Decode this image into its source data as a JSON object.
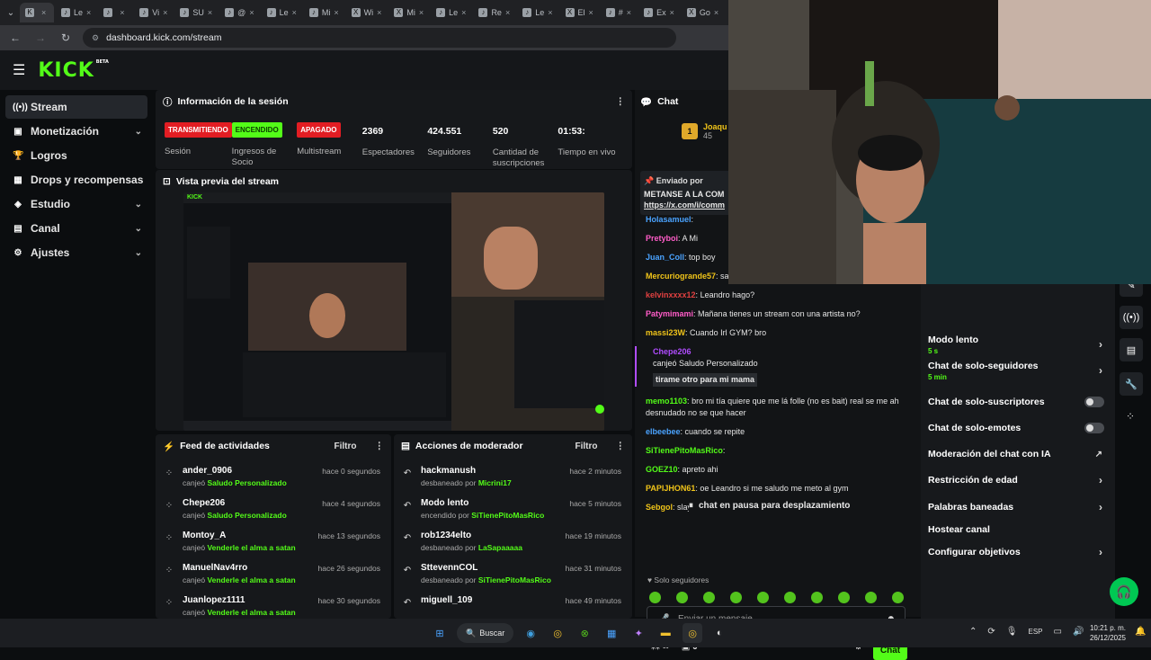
{
  "browser": {
    "tabs": [
      {
        "icon": "kick",
        "label": ""
      },
      {
        "icon": "tiktok",
        "label": "Le"
      },
      {
        "icon": "tiktok",
        "label": ""
      },
      {
        "icon": "tiktok",
        "label": "Vi"
      },
      {
        "icon": "tiktok",
        "label": "SU"
      },
      {
        "icon": "tiktok",
        "label": "@"
      },
      {
        "icon": "tiktok",
        "label": "Le"
      },
      {
        "icon": "tiktok",
        "label": "Mi"
      },
      {
        "icon": "x",
        "label": "Wi"
      },
      {
        "icon": "x",
        "label": "Mi"
      },
      {
        "icon": "tiktok",
        "label": "Le"
      },
      {
        "icon": "tiktok",
        "label": "Re"
      },
      {
        "icon": "tiktok",
        "label": "Le"
      },
      {
        "icon": "x",
        "label": "El"
      },
      {
        "icon": "tiktok",
        "label": "#"
      },
      {
        "icon": "tiktok",
        "label": "Ex"
      },
      {
        "icon": "x",
        "label": "Go"
      },
      {
        "icon": "x",
        "label": "an"
      },
      {
        "icon": "tiktok",
        "label": "Mi"
      }
    ],
    "url": "dashboard.kick.com/stream"
  },
  "kick": {
    "logo": "KICK",
    "logo_badge": "BETA",
    "sidebar": [
      {
        "label": "Stream",
        "icon": "stream-icon",
        "active": true,
        "chevron": false
      },
      {
        "label": "Monetización",
        "icon": "money-icon",
        "active": false,
        "chevron": true
      },
      {
        "label": "Logros",
        "icon": "trophy-icon",
        "active": false,
        "chevron": false
      },
      {
        "label": "Drops y recompensas",
        "icon": "gift-icon",
        "active": false,
        "chevron": false
      },
      {
        "label": "Estudio",
        "icon": "studio-icon",
        "active": false,
        "chevron": true
      },
      {
        "label": "Canal",
        "icon": "channel-icon",
        "active": false,
        "chevron": true
      },
      {
        "label": "Ajustes",
        "icon": "settings-icon",
        "active": false,
        "chevron": true
      }
    ],
    "session": {
      "title": "Información de la sesión",
      "items": [
        {
          "badge": "TRANSMITIENDO",
          "badge_color": "#e21d23",
          "label": "Sesión"
        },
        {
          "badge": "ENCENDIDO",
          "badge_color": "#53fc18",
          "label": "Ingresos de Socio"
        },
        {
          "badge": "APAGADO",
          "badge_color": "#e21d23",
          "label": "Multistream"
        },
        {
          "value": "2369",
          "label": "Espectadores"
        },
        {
          "value": "424.551",
          "label": "Seguidores"
        },
        {
          "value": "520",
          "label": "Cantidad de suscripciones"
        },
        {
          "value": "01:53:",
          "label": "Tiempo en vivo"
        }
      ]
    },
    "preview": {
      "title": "Vista previa del stream"
    },
    "feed": {
      "title": "Feed de actividades",
      "filter": "Filtro",
      "rows": [
        {
          "name": "ander_0906",
          "action": "canjeó",
          "reward": "Saludo Personalizado",
          "time": "hace 0 segundos"
        },
        {
          "name": "Chepe206",
          "action": "canjeó",
          "reward": "Saludo Personalizado",
          "time": "hace 4 segundos"
        },
        {
          "name": "Montoy_A",
          "action": "canjeó",
          "reward": "Venderle el alma a satan",
          "time": "hace 13 segundos"
        },
        {
          "name": "ManuelNav4rro",
          "action": "canjeó",
          "reward": "Venderle el alma a satan",
          "time": "hace 26 segundos"
        },
        {
          "name": "Juanlopez1111",
          "action": "canjeó",
          "reward": "Venderle el alma a satan",
          "time": "hace 30 segundos"
        }
      ]
    },
    "modactions": {
      "title": "Acciones de moderador",
      "filter": "Filtro",
      "rows": [
        {
          "name": "hackmanush",
          "action": "desbaneado por",
          "by": "Micrini17",
          "time": "hace 2 minutos"
        },
        {
          "name": "Modo lento",
          "action": "encendido por",
          "by": "SiTienePitoMasRico",
          "time": "hace 5 minutos"
        },
        {
          "name": "rob1234elto",
          "action": "desbaneado por",
          "by": "LaSapaaaaa",
          "time": "hace 19 minutos"
        },
        {
          "name": "SttevennCOL",
          "action": "desbaneado por",
          "by": "SiTienePitoMasRico",
          "time": "hace 31 minutos"
        },
        {
          "name": "miguell_109",
          "action": "",
          "by": "",
          "time": "hace 49 minutos"
        }
      ]
    },
    "chat": {
      "title": "Chat",
      "top_user": "Joaqu",
      "top_count": "45",
      "top_rank": "1",
      "pinned_label": "Enviado por",
      "pinned_text": "METANSE A LA COM",
      "pinned_link": "https://x.com/i/comm",
      "messages": [
        {
          "user": "Holasamuel",
          "color": "#4aa3ff",
          "text": ""
        },
        {
          "user": "Pretyboi",
          "color": "#ff5cc8",
          "text": "A Mi"
        },
        {
          "user": "Juan_Coll",
          "color": "#4aa3ff",
          "text": "top boy"
        },
        {
          "user": "Mercuriogrande57",
          "color": "#f0c419",
          "text": "sa"
        },
        {
          "user": "kelvinxxxx12",
          "color": "#e04040",
          "text": "Leandro hago?"
        },
        {
          "user": "Patymimami",
          "color": "#ff5cc8",
          "text": "Mañana tienes un stream con una artista no?"
        },
        {
          "user": "massi23W",
          "color": "#f0c419",
          "text": "Cuando Irl GYM? bro"
        }
      ],
      "redeem_user": "Chepe206",
      "redeem_action": "canjeó Saludo Personalizado",
      "redeem_msg": "tirame otro para mi mama",
      "messages2": [
        {
          "user": "memo1103",
          "color": "#53fc18",
          "text": "bro mi tía quiere que me lá folle (no es bait) real se me ah desnudado no se que hacer"
        },
        {
          "user": "elbeebee",
          "color": "#4aa3ff",
          "text": "cuando se repite"
        },
        {
          "user": "SiTienePitoMasRico",
          "color": "#53fc18",
          "text": ""
        },
        {
          "user": "GOEZ10",
          "color": "#53fc18",
          "text": "apreto ahi"
        },
        {
          "user": "PAPIJHON61",
          "color": "#f0c419",
          "text": "oe Leandro si me saludo me meto al gym"
        },
        {
          "user": "Sebgol",
          "color": "#f0c419",
          "text": "slay"
        }
      ],
      "paused": "chat en pausa para desplazamiento",
      "followers_only": "Solo seguidores",
      "input_placeholder": "Enviar un mensaje",
      "count": "0",
      "send": "Chat"
    },
    "modpanel": {
      "rows": [
        {
          "label": "Modo lento",
          "sub": "5 s",
          "type": "arrow"
        },
        {
          "label": "Chat de solo-seguidores",
          "sub": "5 min",
          "type": "arrow"
        },
        {
          "label": "Chat de solo-suscriptores",
          "sub": "",
          "type": "toggle"
        },
        {
          "label": "Chat de solo-emotes",
          "sub": "",
          "type": "toggle"
        },
        {
          "label": "Moderación del chat con IA",
          "sub": "",
          "type": "external"
        },
        {
          "label": "Restricción de edad",
          "sub": "",
          "type": "arrow"
        },
        {
          "label": "Palabras baneadas",
          "sub": "",
          "type": "arrow"
        },
        {
          "label": "Hostear canal",
          "sub": "",
          "type": "none"
        },
        {
          "label": "Configurar objetivos",
          "sub": "",
          "type": "arrow"
        }
      ]
    }
  },
  "taskbar": {
    "search": "Buscar",
    "lang": "ESP",
    "time": "10:21 p. m.",
    "date": "26/12/2025"
  }
}
